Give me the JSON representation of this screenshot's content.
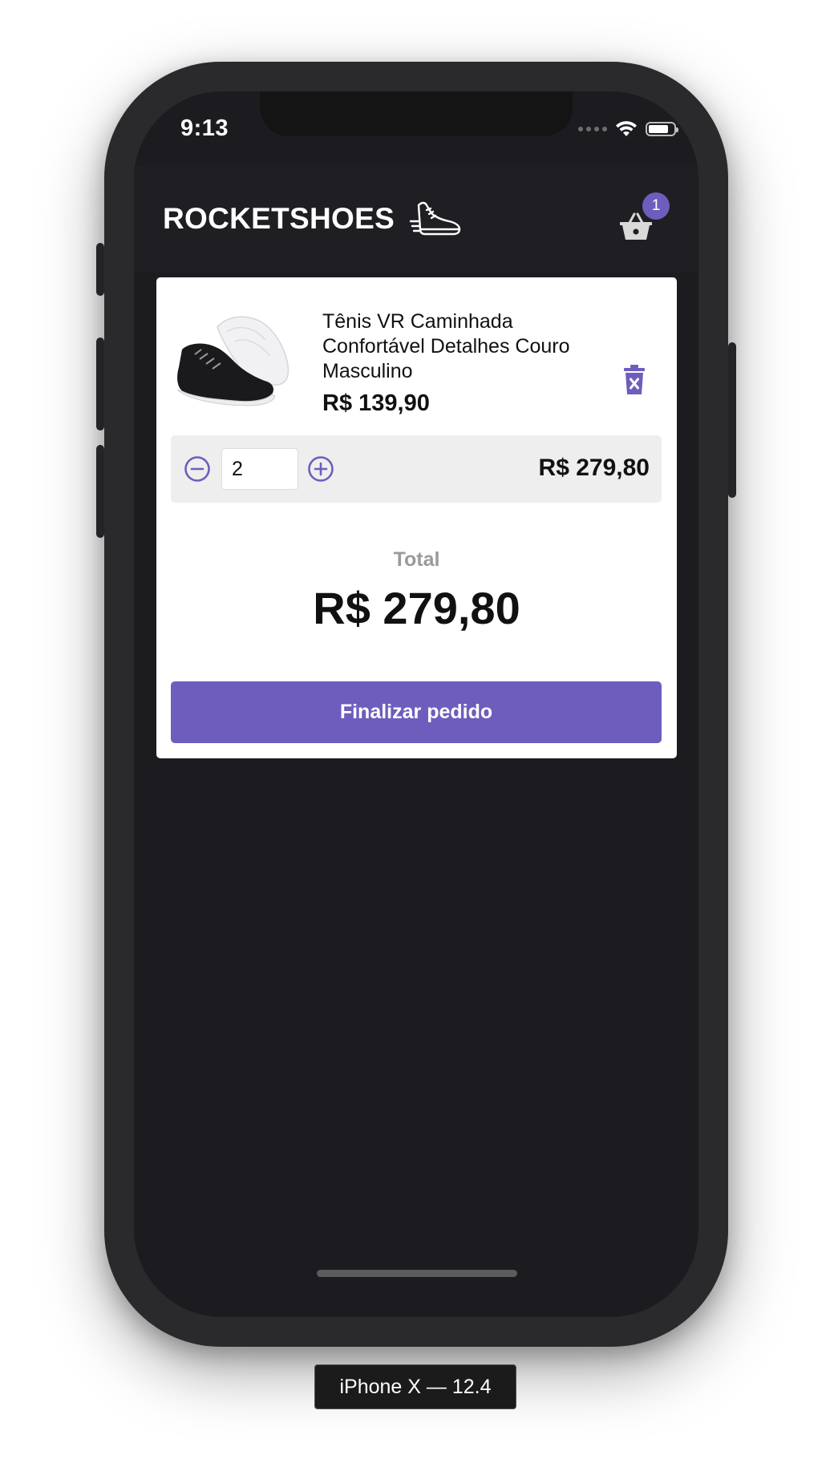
{
  "status_bar": {
    "time": "9:13"
  },
  "header": {
    "logo_text": "ROCKETSHOES",
    "logo_icon": "sneaker-icon",
    "cart_icon": "basket-icon",
    "cart_count": "1"
  },
  "cart": {
    "items": [
      {
        "title": "Tênis VR Caminhada Confortável Detalhes Couro Masculino",
        "price": "R$ 139,90",
        "quantity": "2",
        "subtotal": "R$ 279,80",
        "delete_icon": "trash-icon",
        "decrement_icon": "minus-circle-icon",
        "increment_icon": "plus-circle-icon"
      }
    ],
    "total_label": "Total",
    "total_value": "R$ 279,80",
    "checkout_label": "Finalizar pedido"
  },
  "device_label": "iPhone X — 12.4",
  "colors": {
    "accent": "#6e5dbd",
    "header_bg": "#1f1e22",
    "screen_bg": "#1c1b1f",
    "card_bg": "#ffffff",
    "qty_bar_bg": "#eeeeee"
  }
}
